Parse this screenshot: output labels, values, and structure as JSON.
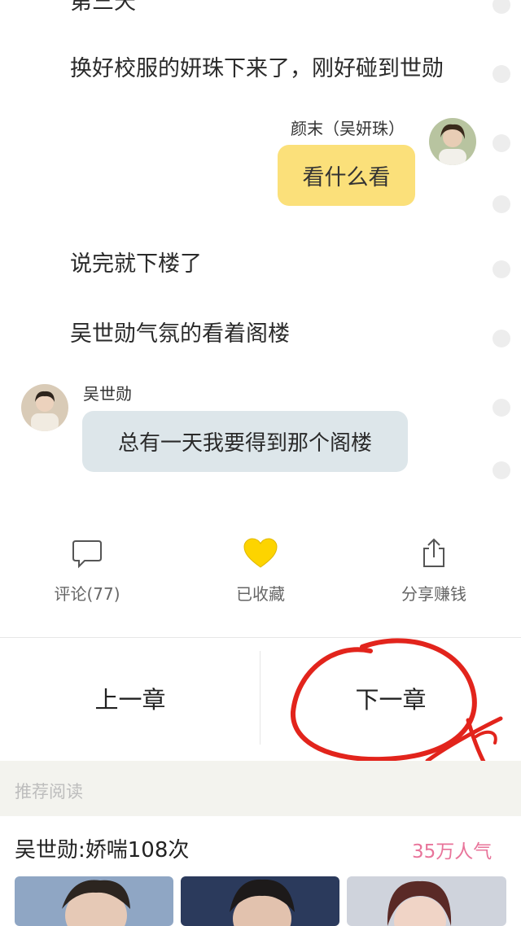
{
  "story": {
    "cut_top_line": "第三天",
    "line1": "换好校服的妍珠下来了，刚好碰到世勋",
    "line2": "说完就下楼了",
    "line3": "吴世勋气氛的看着阁楼"
  },
  "chat": {
    "right": {
      "speaker": "颜末（吴妍珠）",
      "message": "看什么看"
    },
    "left": {
      "speaker": "吴世勋",
      "message": "总有一天我要得到那个阁楼"
    }
  },
  "actions": {
    "comment": {
      "label": "评论(77)",
      "icon": "speech-bubble-icon"
    },
    "favorite": {
      "label": "已收藏",
      "icon": "heart-icon"
    },
    "share": {
      "label": "分享赚钱",
      "icon": "share-icon"
    }
  },
  "chapter_nav": {
    "prev_label": "上一章",
    "next_label": "下一章"
  },
  "recommend": {
    "section_title": "推荐阅读",
    "book_title": "吴世勋:娇喘108次",
    "popularity": "35万人气"
  },
  "colors": {
    "accent_yellow": "#fbe07a",
    "left_bubble": "#dde6ea",
    "pink": "#e8749a",
    "annotation_red": "#e2241c"
  }
}
